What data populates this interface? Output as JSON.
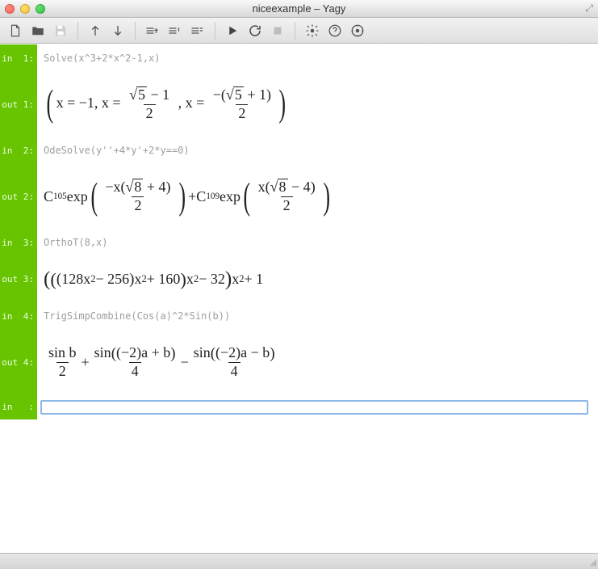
{
  "window": {
    "title": "niceexample – Yagy"
  },
  "cells": {
    "in1": {
      "label": "in  1:",
      "code": "Solve(x^3+2*x^2-1,x)"
    },
    "out1": {
      "label": "out 1:"
    },
    "in2": {
      "label": "in  2:",
      "code": "OdeSolve(y''+4*y'+2*y==0)"
    },
    "out2": {
      "label": "out 2:"
    },
    "in3": {
      "label": "in  3:",
      "code": "OrthoT(8,x)"
    },
    "out3": {
      "label": "out 3:"
    },
    "in4": {
      "label": "in  4:",
      "code": "TrigSimpCombine(Cos(a)^2*Sin(b))"
    },
    "out4": {
      "label": "out 4:"
    },
    "in5": {
      "label": "in   :",
      "value": ""
    }
  },
  "math": {
    "out1": {
      "latex": "( x = -1 , x = (\\sqrt{5} - 1)/2 , x = -(\\sqrt{5} + 1)/2 )",
      "parts": {
        "sol1": "x = −1",
        "comma": ",",
        "xeq": "x = ",
        "s5": "5",
        "minus1": " − 1",
        "two": "2",
        "neg_open": "−(",
        "plus1": " + 1)",
        "close": ""
      }
    },
    "out2": {
      "latex": "C_{105} exp( -x(\\sqrt{8}+4)/2 ) + C_{109} exp( x(\\sqrt{8}-4)/2 )",
      "parts": {
        "C": "C",
        "sub105": "105",
        "exp": " exp",
        "negx": "−x",
        "s8": "8",
        "plus4": " + 4",
        "two": "2",
        "plus": " + ",
        "sub109": "109",
        "x": "x",
        "minus4": " − 4"
      }
    },
    "out3": {
      "latex": "(((128x^2 - 256) x^2 + 160) x^2 - 32) x^2 + 1",
      "text": "(((128x² − 256)x² + 160)x² − 32)x² + 1"
    },
    "out4": {
      "latex": "sin b / 2 + sin((-2)a + b)/4 - sin((-2)a - b)/4",
      "parts": {
        "sinb": "sin b",
        "two": "2",
        "plus": " + ",
        "sin": "sin",
        "neg2a": "(−2)a + b",
        "four": "4",
        "minus": " − ",
        "neg2am": "(−2)a − b"
      }
    }
  }
}
